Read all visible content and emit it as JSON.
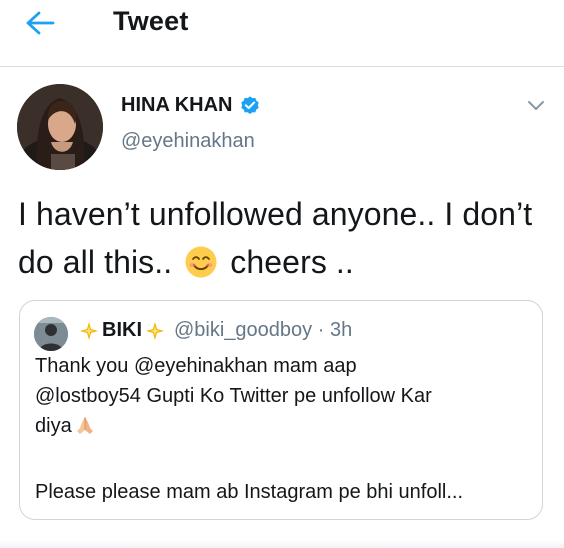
{
  "header": {
    "title": "Tweet",
    "back_icon": "arrow-left-icon"
  },
  "colors": {
    "accent": "#1da1f2",
    "text": "#14171a",
    "muted": "#657786",
    "border": "#ccd6dd"
  },
  "tweet": {
    "author_name": "HINA KHAN",
    "author_handle": "@eyehinakhan",
    "verified": true,
    "text_part1": "I haven’t unfollowed anyone.. I don’t do all this..",
    "text_part2": "cheers ..",
    "emoji": "smiling-face-icon"
  },
  "quote": {
    "name": "BIKI",
    "handle_time": "@biki_goodboy · 3h",
    "line1": "Thank you @eyehinakhan mam aap",
    "line2": "@lostboy54 Gupti Ko Twitter pe unfollow Kar",
    "line3": "diya",
    "line4": "Please please mam ab Instagram pe bhi unfoll..."
  }
}
